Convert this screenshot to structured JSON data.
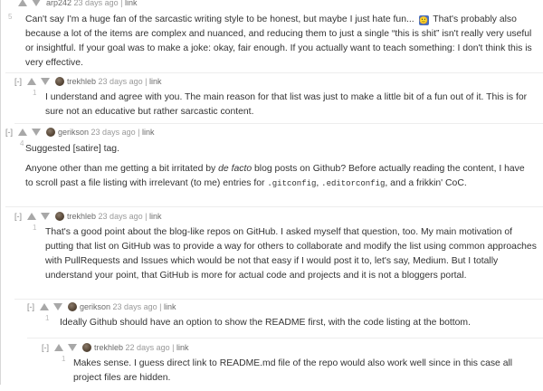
{
  "comments": [
    {
      "user": "arp242",
      "age": "23 days ago",
      "sep": "|",
      "link": "link",
      "collapse": "",
      "score": "5",
      "has_avatar": false,
      "paragraphs": [
        {
          "parts": [
            "Can't say I'm a huge fan of the sarcastic writing style to be honest, but maybe I just hate fun... ",
            "🙂",
            " That's probably also because a lot of the items are complex and nuanced, and reducing them to just a single “this is shit” isn't really very useful or insightful. If your goal was to make a joke: okay, fair enough. If you actually want to teach something: I don't think this is very effective."
          ]
        }
      ]
    },
    {
      "user": "trekhleb",
      "age": "23 days ago",
      "sep": "|",
      "link": "link",
      "collapse": "[-]",
      "score": "1",
      "has_avatar": true,
      "paragraphs": [
        {
          "text": "I understand and agree with you. The main reason for that list was just to make a little bit of a fun out of it. This is for sure not an educative but rather sarcastic content."
        }
      ]
    },
    {
      "user": "gerikson",
      "age": "23 days ago",
      "sep": "|",
      "link": "link",
      "collapse": "[-]",
      "score": "4",
      "has_avatar": true,
      "paragraphs": [
        {
          "text": "Suggested [satire] tag."
        },
        {
          "parts": [
            "Anyone other than me getting a bit irritated by ",
            "de facto",
            " blog posts on Github? Before actually reading the content, I have to scroll past a file listing with irrelevant (to me) entries for ",
            ".gitconfig",
            ", ",
            ".editorconfig",
            ", and a frikkin' CoC."
          ]
        }
      ]
    },
    {
      "user": "trekhleb",
      "age": "23 days ago",
      "sep": "|",
      "link": "link",
      "collapse": "[-]",
      "score": "1",
      "has_avatar": true,
      "paragraphs": [
        {
          "text": "That's a good point about the blog-like repos on GitHub. I asked myself that question, too. My main motivation of putting that list on GitHub was to provide a way for others to collaborate and modify the list using common approaches with PullRequests and Issues which would be not that easy if I would post it to, let's say, Medium. But I totally understand your point, that GitHub is more for actual code and projects and it is not a bloggers portal."
        }
      ]
    },
    {
      "user": "gerikson",
      "age": "23 days ago",
      "sep": "|",
      "link": "link",
      "collapse": "[-]",
      "score": "1",
      "has_avatar": true,
      "paragraphs": [
        {
          "text": "Ideally Github should have an option to show the README first, with the code listing at the bottom."
        }
      ]
    },
    {
      "user": "trekhleb",
      "age": "22 days ago",
      "sep": "|",
      "link": "link",
      "collapse": "[-]",
      "score": "1",
      "has_avatar": true,
      "paragraphs": [
        {
          "text": "Makes sense. I guess direct link to README.md file of the repo would also work well since in this case all project files are hidden."
        }
      ]
    }
  ]
}
